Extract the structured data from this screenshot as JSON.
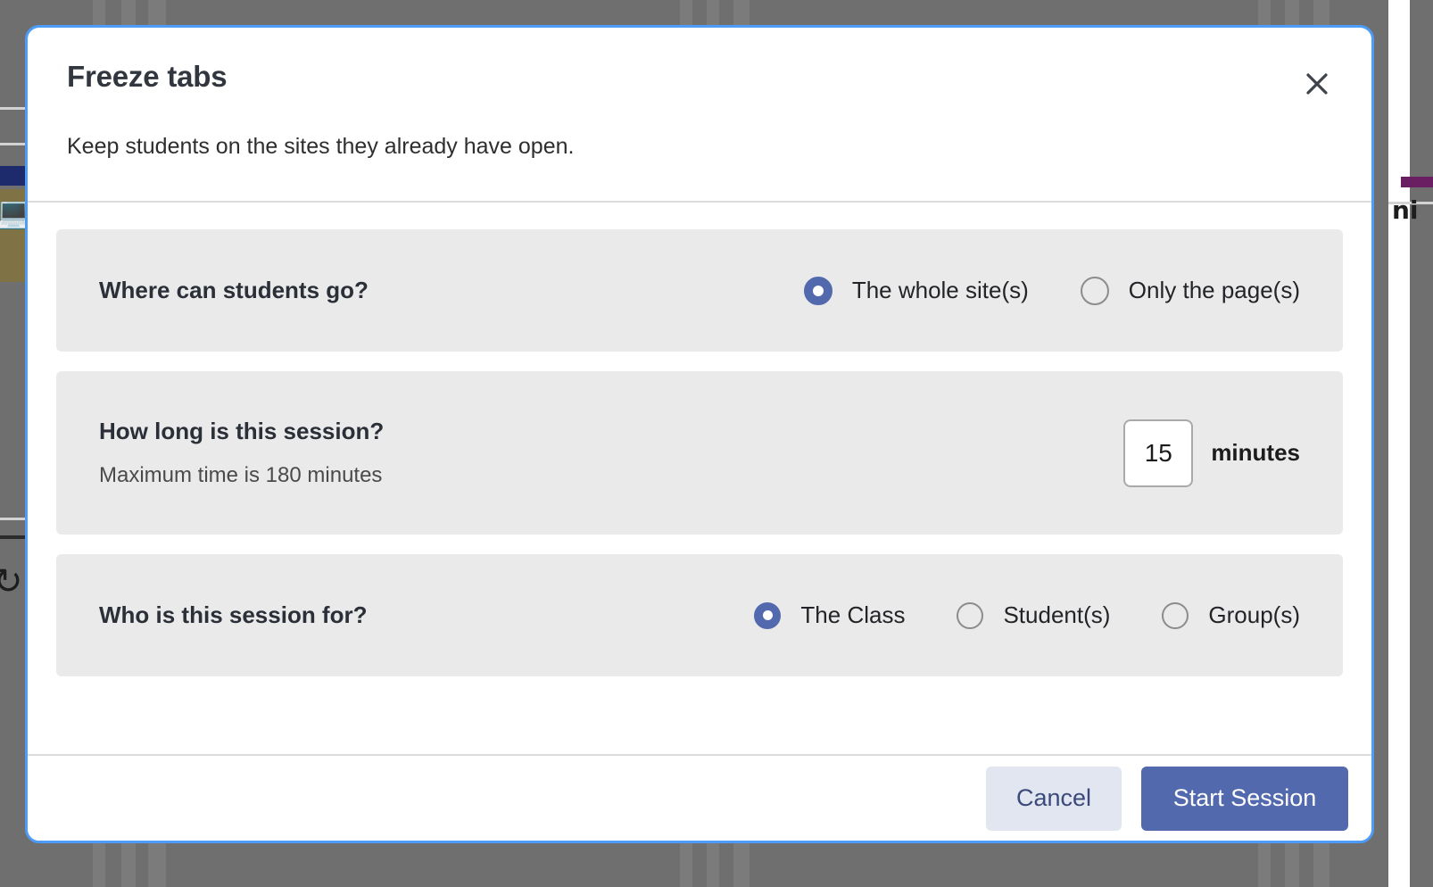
{
  "modal": {
    "title": "Freeze tabs",
    "subtitle": "Keep students on the sites they already have open.",
    "close_icon": "close-icon",
    "accent_color": "#5369ae",
    "focus_border_color": "#4d9cf7",
    "section_bg_color": "#eaeaea"
  },
  "sections": [
    {
      "label": "Where can students go?",
      "sublabel": "",
      "options": [
        {
          "label": "The whole site(s)",
          "selected": true
        },
        {
          "label": "Only the page(s)",
          "selected": false
        }
      ]
    },
    {
      "label": "How long is this session?",
      "sublabel": "Maximum time is 180 minutes",
      "duration": {
        "value": "15",
        "placeholder": "15",
        "unit": "minutes",
        "max_minutes": 180
      }
    },
    {
      "label": "Who is this session for?",
      "sublabel": "",
      "options": [
        {
          "label": "The Class",
          "selected": true
        },
        {
          "label": "Student(s)",
          "selected": false
        },
        {
          "label": "Group(s)",
          "selected": false
        }
      ]
    }
  ],
  "footer": {
    "cancel_label": "Cancel",
    "start_label": "Start Session"
  }
}
